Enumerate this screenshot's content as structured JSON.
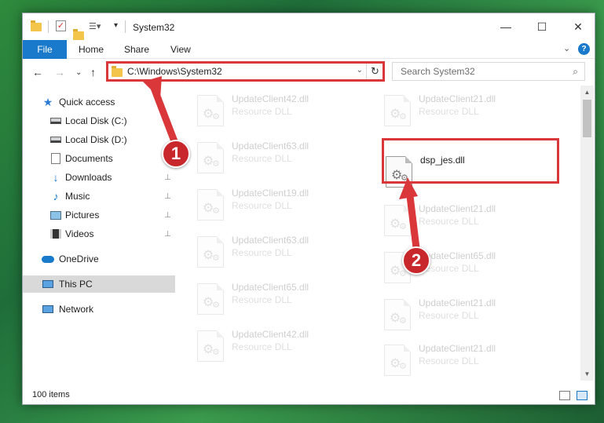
{
  "window": {
    "title": "System32",
    "quick_access_toolbar": [
      "folder-icon",
      "properties-check-icon",
      "new-folder-icon",
      "customize-icon"
    ],
    "controls": {
      "minimize": "—",
      "maximize": "☐",
      "close": "✕"
    }
  },
  "ribbon": {
    "tabs": [
      "File",
      "Home",
      "Share",
      "View"
    ],
    "expand_symbol": "⌄",
    "help_symbol": "?"
  },
  "navigation": {
    "back": "←",
    "forward": "→",
    "recent": "⌄",
    "up": "↑",
    "address": "C:\\Windows\\System32",
    "address_dropdown": "⌄",
    "refresh": "↻",
    "search_placeholder": "Search System32",
    "search_icon": "⌕"
  },
  "sidebar": {
    "items": [
      {
        "label": "Quick access",
        "icon": "star-icon",
        "pinned": false
      },
      {
        "label": "Local Disk (C:)",
        "icon": "disk-icon",
        "pinned": false
      },
      {
        "label": "Local Disk (D:)",
        "icon": "disk-icon",
        "pinned": false
      },
      {
        "label": "Documents",
        "icon": "document-icon",
        "pinned": true
      },
      {
        "label": "Downloads",
        "icon": "download-icon",
        "pinned": true
      },
      {
        "label": "Music",
        "icon": "music-icon",
        "pinned": true
      },
      {
        "label": "Pictures",
        "icon": "picture-icon",
        "pinned": true
      },
      {
        "label": "Videos",
        "icon": "video-icon",
        "pinned": true
      },
      {
        "label": "OneDrive",
        "icon": "cloud-icon",
        "pinned": false
      },
      {
        "label": "This PC",
        "icon": "computer-icon",
        "pinned": false,
        "selected": true
      },
      {
        "label": "Network",
        "icon": "network-icon",
        "pinned": false
      }
    ],
    "pin_symbol": "📌"
  },
  "files": {
    "left_column": [
      {
        "name": "UpdateClient42.dll",
        "type": "Resource DLL"
      },
      {
        "name": "UpdateClient63.dll",
        "type": "Resource DLL"
      },
      {
        "name": "UpdateClient19.dll",
        "type": "Resource DLL"
      },
      {
        "name": "UpdateClient63.dll",
        "type": "Resource DLL"
      },
      {
        "name": "UpdateClient65.dll",
        "type": "Resource DLL"
      },
      {
        "name": "UpdateClient42.dll",
        "type": "Resource DLL"
      }
    ],
    "right_column": [
      {
        "name": "UpdateClient21.dll",
        "type": "Resource DLL"
      },
      {
        "name": "dsp_jes.dll",
        "type": "",
        "highlighted": true
      },
      {
        "name": "UpdateClient21.dll",
        "type": "Resource DLL"
      },
      {
        "name": "UpdateClient65.dll",
        "type": "Resource DLL"
      },
      {
        "name": "UpdateClient21.dll",
        "type": "Resource DLL"
      },
      {
        "name": "UpdateClient21.dll",
        "type": "Resource DLL"
      }
    ],
    "gear_symbol": "⚙"
  },
  "scrollbar": {
    "up": "▲",
    "down": "▼"
  },
  "status": {
    "item_count": "100 items"
  },
  "annotations": {
    "step1": "1",
    "step2": "2",
    "color": "#d9373a"
  }
}
